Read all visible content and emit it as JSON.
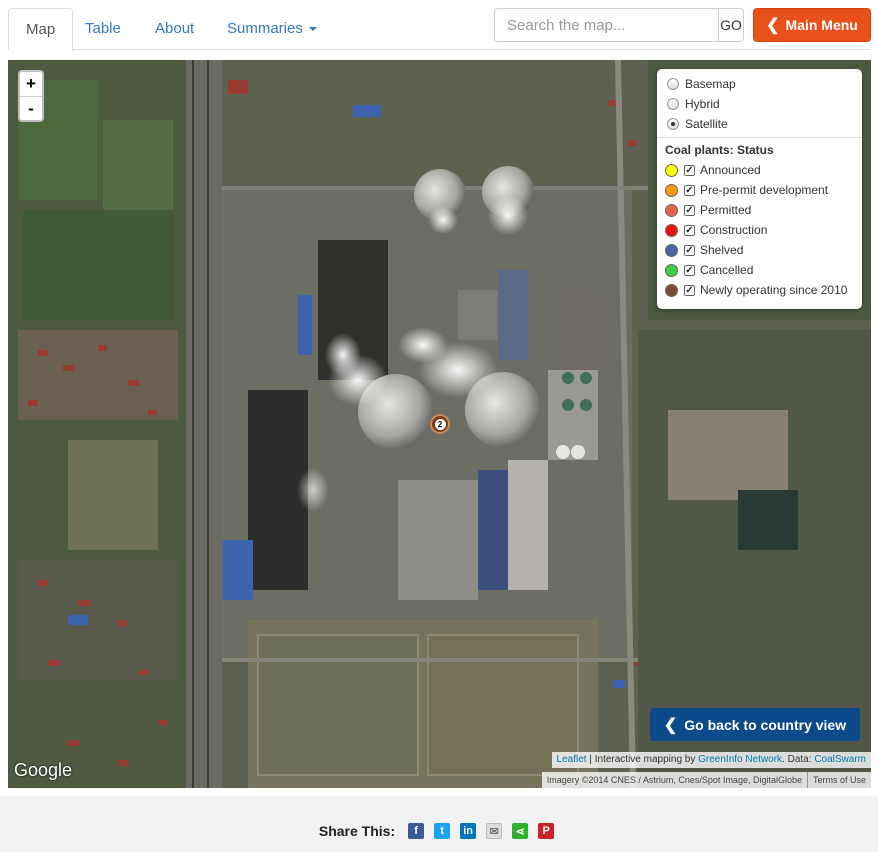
{
  "nav": {
    "tabs": [
      {
        "label": "Map",
        "active": true
      },
      {
        "label": "Table"
      },
      {
        "label": "About"
      },
      {
        "label": "Summaries"
      }
    ],
    "search_placeholder": "Search the map...",
    "go_label": "GO",
    "main_menu_label": "Main Menu",
    "main_menu_color": "#e8501c"
  },
  "map": {
    "zoom_in": "+",
    "zoom_out": "-",
    "basemaps": [
      {
        "label": "Basemap",
        "selected": false
      },
      {
        "label": "Hybrid",
        "selected": false
      },
      {
        "label": "Satellite",
        "selected": true
      }
    ],
    "status_title": "Coal plants: Status",
    "statuses": [
      {
        "label": "Announced",
        "color": "#ffff00",
        "checked": true
      },
      {
        "label": "Pre-permit development",
        "color": "#ff9900",
        "checked": true
      },
      {
        "label": "Permitted",
        "color": "#e8634a",
        "checked": true
      },
      {
        "label": "Construction",
        "color": "#ee1111",
        "checked": true
      },
      {
        "label": "Shelved",
        "color": "#4a63a4",
        "checked": true
      },
      {
        "label": "Cancelled",
        "color": "#44cc44",
        "checked": true
      },
      {
        "label": "Newly operating since 2010",
        "color": "#7a4a32",
        "checked": true
      }
    ],
    "marker_count": "2",
    "back_button": "Go back to country view",
    "attribution": {
      "leaflet": "Leaflet",
      "sep": " | Interactive mapping by ",
      "greeninfo": "GreenInfo Network",
      "data": ". Data: ",
      "coalswarm": "CoalSwarm",
      "imagery": "Imagery ©2014 CNES / Astrium, Cnes/Spot Image, DigitalGlobe",
      "terms": "Terms of Use",
      "google": "Google"
    }
  },
  "footer": {
    "share_label": "Share This:",
    "icons": [
      "facebook-icon",
      "twitter-icon",
      "linkedin-icon",
      "email-icon",
      "share-icon",
      "pinterest-icon"
    ]
  }
}
